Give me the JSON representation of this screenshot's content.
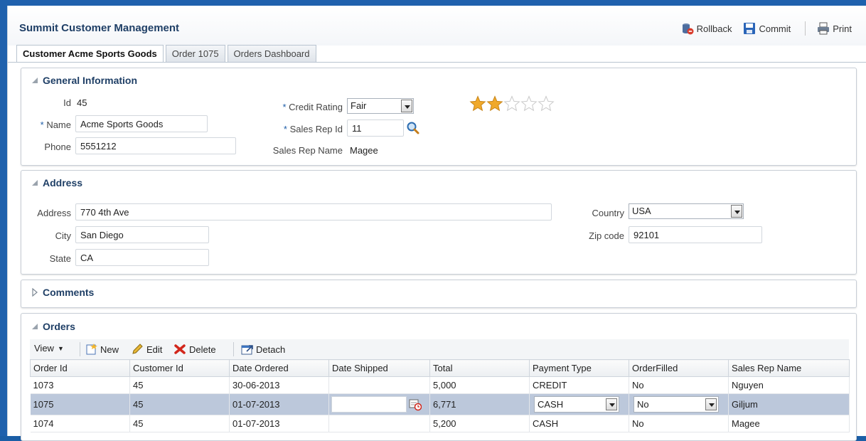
{
  "header": {
    "title": "Summit Customer Management",
    "rollback_label": "Rollback",
    "commit_label": "Commit",
    "print_label": "Print"
  },
  "tabs": [
    {
      "label": "Customer Acme Sports Goods",
      "active": true
    },
    {
      "label": "Order 1075",
      "active": false
    },
    {
      "label": "Orders Dashboard",
      "active": false
    }
  ],
  "general": {
    "title": "General Information",
    "id_label": "Id",
    "id_value": "45",
    "required_mark": "*",
    "name_label": "Name",
    "name_value": "Acme Sports Goods",
    "phone_label": "Phone",
    "phone_value": "5551212",
    "credit_label": "Credit Rating",
    "credit_value": "Fair",
    "salesrep_label": "Sales Rep Id",
    "salesrep_value": "11",
    "salesrep_name_label": "Sales Rep Name",
    "salesrep_name_value": "Magee",
    "rating_stars": 2,
    "rating_max": 5
  },
  "address": {
    "title": "Address",
    "address_label": "Address",
    "address_value": "770 4th Ave",
    "city_label": "City",
    "city_value": "San Diego",
    "state_label": "State",
    "state_value": "CA",
    "country_label": "Country",
    "country_value": "USA",
    "zip_label": "Zip code",
    "zip_value": "92101"
  },
  "comments": {
    "title": "Comments"
  },
  "orders": {
    "title": "Orders",
    "toolbar": {
      "view_label": "View",
      "new_label": "New",
      "edit_label": "Edit",
      "delete_label": "Delete",
      "detach_label": "Detach"
    },
    "columns": [
      "Order Id",
      "Customer Id",
      "Date Ordered",
      "Date Shipped",
      "Total",
      "Payment Type",
      "OrderFilled",
      "Sales Rep Name"
    ],
    "rows": [
      [
        "1073",
        "45",
        "30-06-2013",
        "",
        "5,000",
        "CREDIT",
        "No",
        "Nguyen"
      ],
      [
        "1075",
        "45",
        "01-07-2013",
        "",
        "6,771",
        "CASH",
        "No",
        "Giljum"
      ],
      [
        "1074",
        "45",
        "01-07-2013",
        "",
        "5,200",
        "CASH",
        "No",
        "Magee"
      ]
    ]
  },
  "colors": {
    "frame": "#1f61ad",
    "title": "#1f3f66",
    "selected_row": "#bcc8db",
    "star": "#f0a92a"
  }
}
